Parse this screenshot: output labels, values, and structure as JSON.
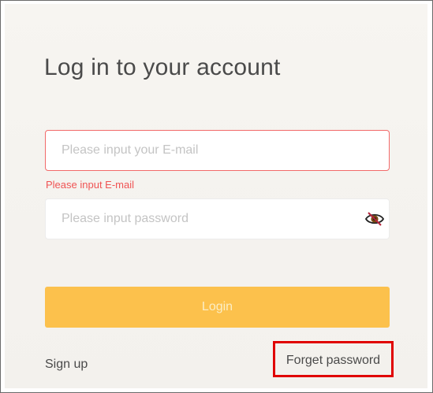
{
  "login_form": {
    "title": "Log in to your account",
    "email": {
      "value": "",
      "placeholder": "Please input your E-mail",
      "error": "Please input E-mail"
    },
    "password": {
      "value": "",
      "placeholder": "Please input password",
      "toggle_icon": "eye-slash-icon"
    },
    "login_label": "Login",
    "signup_label": "Sign up",
    "forget_label": "Forget password"
  },
  "colors": {
    "error": "#f05454",
    "accent": "#fcc14c",
    "highlight_box": "#e00000"
  }
}
